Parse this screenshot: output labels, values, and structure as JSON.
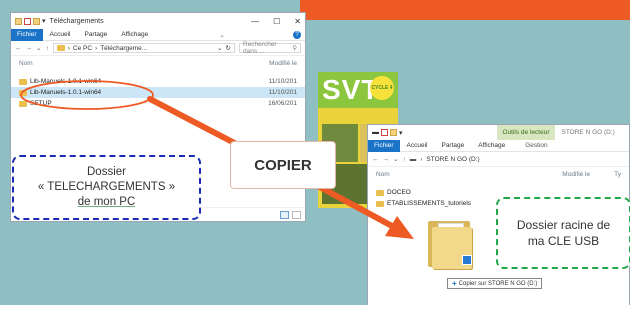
{
  "colors": {
    "banner": "#ee5a24",
    "arrow": "#ee5a24",
    "dl_border": "#1a2bb5",
    "usb_border": "#21a84a",
    "selection": "#cce6f7",
    "ribbon_file": "#1a73c7"
  },
  "left_window": {
    "title": "Téléchargements",
    "ribbon": {
      "file": "Fichier",
      "tabs": [
        "Accueil",
        "Partage",
        "Affichage"
      ]
    },
    "address": {
      "path": [
        "Ce PC",
        "Téléchargeme..."
      ],
      "search_placeholder": "Rechercher dans ..."
    },
    "columns": {
      "name": "Nom",
      "modified": "Modifié le"
    },
    "rows": [
      {
        "name": "Lib-Manuels-1.0.1-win64",
        "date": "11/10/201"
      },
      {
        "name": "Lib-Manuels-1.0.1-win64",
        "date": "11/10/201"
      },
      {
        "name": "SETUP",
        "date": "16/06/201"
      }
    ]
  },
  "right_window": {
    "context_tab": "Outils de lecteur",
    "drive_label": "STORE N GO (D:)",
    "ribbon": {
      "file": "Fichier",
      "tabs": [
        "Accueil",
        "Partage",
        "Affichage"
      ],
      "manage": "Gestion"
    },
    "address": {
      "path": "STORE N GO (D:)"
    },
    "columns": {
      "name": "Nom",
      "modified": "Modifié le",
      "type": "Ty"
    },
    "rows": [
      {
        "name": "DOCEO"
      },
      {
        "name": "ETABLISSEMENTS_tutoriels"
      }
    ]
  },
  "book": {
    "title": "SVT",
    "cycle": "CYCLE 4"
  },
  "callout_downloads": {
    "line1": "Dossier",
    "line2": "« TELECHARGEMENTS »",
    "line3": "de mon PC"
  },
  "callout_usb": {
    "line1": "Dossier racine de",
    "line2": "ma CLE USB"
  },
  "copier_label": "COPIER",
  "copy_tooltip": "Copier sur STORE N GO (D:)"
}
